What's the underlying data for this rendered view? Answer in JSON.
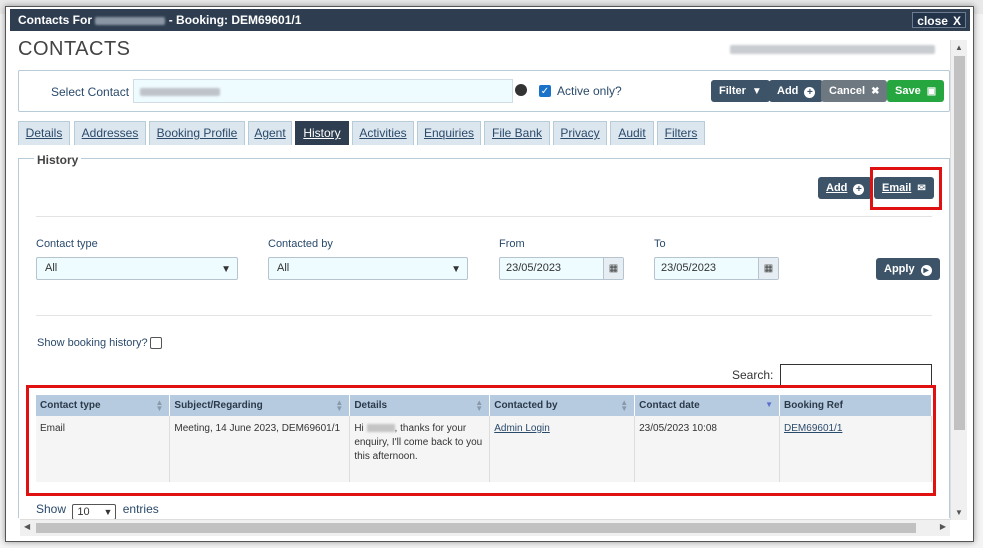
{
  "modal": {
    "title_prefix": "Contacts For",
    "title_suffix": "- Booking: DEM69601/1",
    "close_label": "close",
    "close_glyph": "X",
    "page_title": "CONTACTS"
  },
  "select_bar": {
    "label": "Select Contact",
    "active_only_label": "Active only?",
    "active_only_checked": true,
    "buttons": {
      "filter": "Filter",
      "add": "Add",
      "cancel": "Cancel",
      "save": "Save"
    }
  },
  "tabs": [
    "Details",
    "Addresses",
    "Booking Profile",
    "Agent",
    "History",
    "Activities",
    "Enquiries",
    "File Bank",
    "Privacy",
    "Audit",
    "Filters"
  ],
  "active_tab": "History",
  "history": {
    "legend": "History",
    "add_label": "Add",
    "email_label": "Email",
    "filters": {
      "contact_type_label": "Contact type",
      "contact_type_value": "All",
      "contacted_by_label": "Contacted by",
      "contacted_by_value": "All",
      "from_label": "From",
      "from_value": "23/05/2023",
      "to_label": "To",
      "to_value": "23/05/2023",
      "apply_label": "Apply"
    },
    "show_booking_history_label": "Show booking history?",
    "search_label": "Search:",
    "table": {
      "columns": [
        "Contact type",
        "Subject/Regarding",
        "Details",
        "Contacted by",
        "Contact date",
        "Booking Ref"
      ],
      "rows": [
        {
          "contact_type": "Email",
          "subject": "Meeting, 14 June 2023, DEM69601/1",
          "details_prefix": "Hi",
          "details_suffix": ", thanks for your enquiry, I'll come back to you this afternoon.",
          "contacted_by": "Admin Login",
          "contact_date": "23/05/2023 10:08",
          "booking_ref": "DEM69601/1"
        }
      ]
    },
    "show_label": "Show",
    "entries_value": "10",
    "entries_label": "entries"
  },
  "colors": {
    "titlebar": "#2e3e50",
    "button_dark": "#3d5468",
    "save_green": "#26a63f",
    "highlight_red": "#e01111"
  }
}
